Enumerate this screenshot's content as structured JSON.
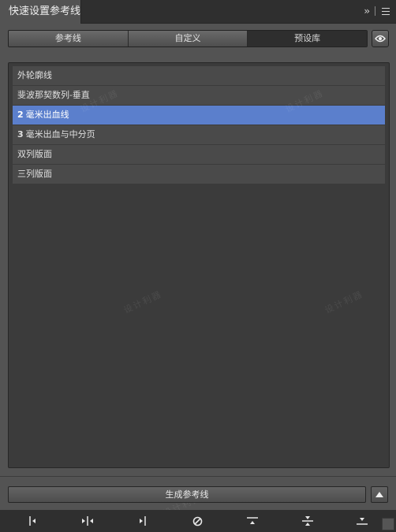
{
  "panel": {
    "title": "快速设置参考线"
  },
  "tabs": [
    {
      "label": "参考线"
    },
    {
      "label": "自定义"
    },
    {
      "label": "预设库"
    }
  ],
  "presets": [
    {
      "num": "",
      "label": "外轮廓线"
    },
    {
      "num": "",
      "label": "斐波那契数列-垂直"
    },
    {
      "num": "2",
      "label": "毫米出血线"
    },
    {
      "num": "3",
      "label": "毫米出血与中分页"
    },
    {
      "num": "",
      "label": "双列版面"
    },
    {
      "num": "",
      "label": "三列版面"
    }
  ],
  "generate_button": {
    "label": "生成参考线"
  },
  "watermark": {
    "text": "设计利器"
  },
  "icons": {
    "expand": "double-chevron-right-icon",
    "menu": "hamburger-menu-icon",
    "eye": "eye-icon",
    "up": "triangle-up-icon",
    "tools": [
      "align-left-guide-icon",
      "center-vertical-guide-icon",
      "align-right-guide-icon",
      "clear-guides-icon",
      "align-top-guide-icon",
      "center-horizontal-guide-icon",
      "align-bottom-guide-icon"
    ]
  },
  "colors": {
    "selected_row": "#5b7fcc",
    "panel_bg": "#535353",
    "list_bg": "#3b3b3b"
  }
}
